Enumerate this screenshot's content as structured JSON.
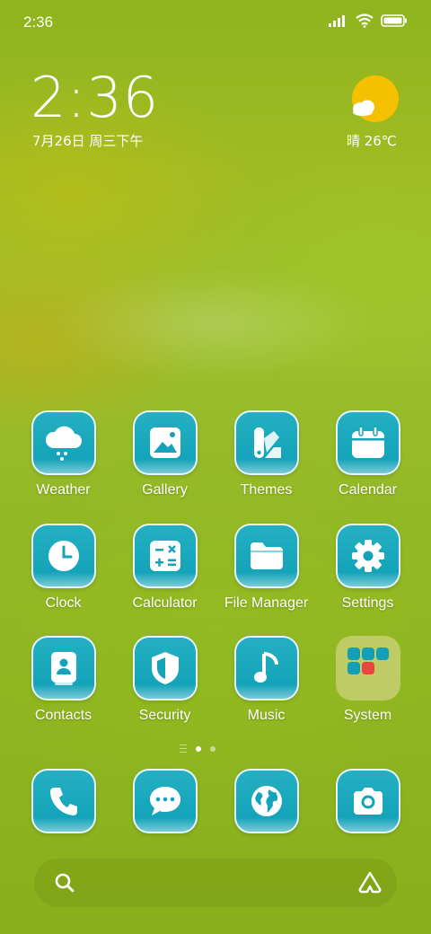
{
  "status_bar": {
    "time": "2:36",
    "icons": [
      "signal-icon",
      "wifi-icon",
      "battery-icon"
    ]
  },
  "lock_widget": {
    "time": "2:36",
    "date": "7月26日 周三下午",
    "weather": {
      "icon": "sunny-cloud-icon",
      "text": "晴 26℃"
    }
  },
  "apps": [
    {
      "label": "Weather",
      "icon": "weather-cloud-icon"
    },
    {
      "label": "Gallery",
      "icon": "gallery-icon"
    },
    {
      "label": "Themes",
      "icon": "themes-icon"
    },
    {
      "label": "Calendar",
      "icon": "calendar-icon"
    },
    {
      "label": "Clock",
      "icon": "clock-icon"
    },
    {
      "label": "Calculator",
      "icon": "calculator-icon"
    },
    {
      "label": "File Manager",
      "icon": "folder-icon"
    },
    {
      "label": "Settings",
      "icon": "gear-icon"
    },
    {
      "label": "Contacts",
      "icon": "contacts-icon"
    },
    {
      "label": "Security",
      "icon": "shield-icon"
    },
    {
      "label": "Music",
      "icon": "music-note-icon"
    },
    {
      "label": "System",
      "icon": "folder-system-icon"
    }
  ],
  "page_indicator": {
    "pages": 2,
    "current": 1
  },
  "dock": [
    {
      "icon": "phone-icon"
    },
    {
      "icon": "messages-icon"
    },
    {
      "icon": "browser-globe-icon"
    },
    {
      "icon": "camera-icon"
    }
  ],
  "search": {
    "left_icon": "search-icon",
    "right_icon": "app-vault-icon"
  },
  "colors": {
    "tile": "#14a3b9",
    "tile_border": "#ffffff",
    "wallpaper": "#93b826",
    "weather_sun": "#f5c000"
  }
}
